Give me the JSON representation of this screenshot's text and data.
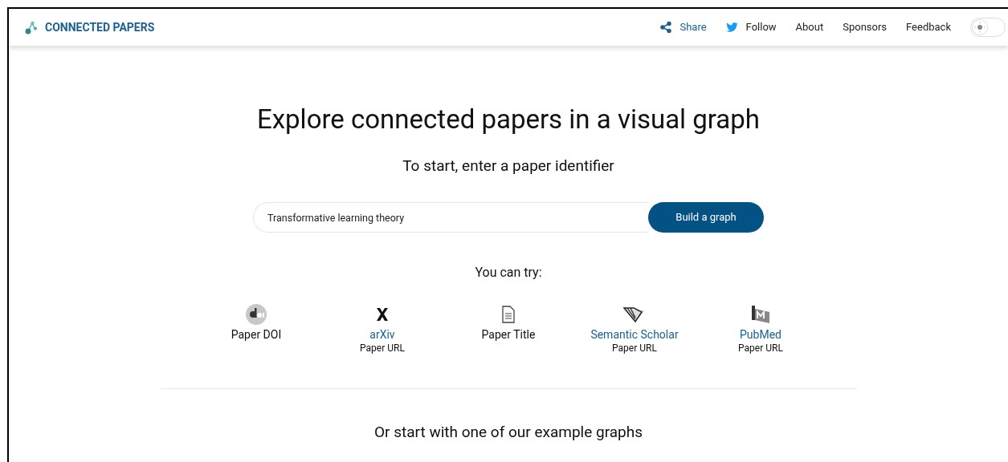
{
  "header": {
    "logo": "CONNECTED PAPERS",
    "nav": [
      {
        "label": "Share",
        "kind": "share"
      },
      {
        "label": "Follow",
        "kind": "follow"
      },
      {
        "label": "About",
        "kind": "plain"
      },
      {
        "label": "Sponsors",
        "kind": "plain"
      },
      {
        "label": "Feedback",
        "kind": "plain"
      }
    ],
    "dark_mode": false
  },
  "hero": {
    "title": "Explore connected papers in a visual graph",
    "subtitle": "To start, enter a paper identifier"
  },
  "search": {
    "value": "Transformative learning theory",
    "button": "Build a graph"
  },
  "try": {
    "heading": "You can try:",
    "items": [
      {
        "kind": "doi",
        "label": "Paper DOI"
      },
      {
        "kind": "arxiv",
        "label": "arXiv",
        "sublabel": "Paper URL"
      },
      {
        "kind": "title",
        "label": "Paper Title"
      },
      {
        "kind": "semantic",
        "label": "Semantic Scholar",
        "sublabel": "Paper URL"
      },
      {
        "kind": "pubmed",
        "label": "PubMed",
        "sublabel": "Paper URL"
      }
    ]
  },
  "examples": {
    "heading": "Or start with one of our example graphs"
  }
}
